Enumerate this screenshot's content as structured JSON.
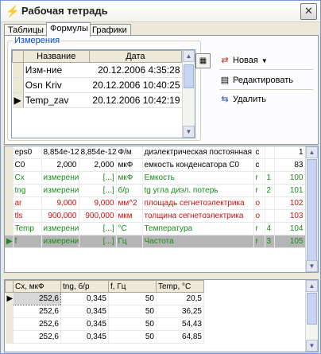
{
  "window": {
    "title": "Рабочая тетрадь",
    "close": "✕"
  },
  "tabs": [
    {
      "label": "Таблицы"
    },
    {
      "label": "Формулы"
    },
    {
      "label": "Графики"
    }
  ],
  "measurements": {
    "group_title": "Измерения",
    "columns": [
      "Название",
      "Дата"
    ],
    "rows": [
      {
        "name": "Изм-ние",
        "date": "20.12.2006 4:35:28"
      },
      {
        "name": "Osn Kriv",
        "date": "20.12.2006 10:40:25"
      },
      {
        "name": "Temp_zav",
        "date": "20.12.2006 10:42:19"
      }
    ]
  },
  "actions": {
    "new": "Новая",
    "edit": "Редактировать",
    "delete": "Удалить"
  },
  "formulas": {
    "rows": [
      {
        "name": "eps0",
        "value": "8,854e-12",
        "computed": "8,854e-12",
        "unit": "Ф/м",
        "desc": "диэлектрическая постоянная",
        "type": "c",
        "n": "",
        "id": "1",
        "style": "normal"
      },
      {
        "name": "C0",
        "value": "2,000",
        "computed": "2,000",
        "unit": "мкФ",
        "desc": "емкость конденсатора C0",
        "type": "c",
        "n": "",
        "id": "83",
        "style": "normal"
      },
      {
        "name": "Cx",
        "value": "измерение",
        "computed": "[...]",
        "unit": "мкФ",
        "desc": "Емкость",
        "type": "r",
        "n": "1",
        "id": "100",
        "style": "green"
      },
      {
        "name": "tng",
        "value": "измерение",
        "computed": "[...]",
        "unit": "б/р",
        "desc": "tg угла диэл. потерь",
        "type": "r",
        "n": "2",
        "id": "101",
        "style": "green"
      },
      {
        "name": "ar",
        "value": "9,000",
        "computed": "9,000",
        "unit": "мм^2",
        "desc": "площадь сегнетоэлектрика",
        "type": "o",
        "n": "",
        "id": "102",
        "style": "red"
      },
      {
        "name": "tls",
        "value": "900,000",
        "computed": "900,000",
        "unit": "мкм",
        "desc": "толщина сегнетоэлектрика",
        "type": "o",
        "n": "",
        "id": "103",
        "style": "red"
      },
      {
        "name": "Temp",
        "value": "измерение",
        "computed": "[...]",
        "unit": "°C",
        "desc": "Температура",
        "type": "r",
        "n": "4",
        "id": "104",
        "style": "green"
      },
      {
        "name": "f",
        "value": "измерение",
        "computed": "[...]",
        "unit": "Гц",
        "desc": "Частота",
        "type": "r",
        "n": "3",
        "id": "105",
        "style": "selected"
      }
    ]
  },
  "data_table": {
    "columns": [
      "Cx, мкФ",
      "tng, б/р",
      "f, Гц",
      "Temp, °C"
    ],
    "rows": [
      [
        "252,6",
        "0,345",
        "50",
        "20,5"
      ],
      [
        "252,6",
        "0,345",
        "50",
        "36,25"
      ],
      [
        "252,6",
        "0,345",
        "50",
        "54,43"
      ],
      [
        "252,6",
        "0,345",
        "50",
        "64,85"
      ]
    ]
  }
}
